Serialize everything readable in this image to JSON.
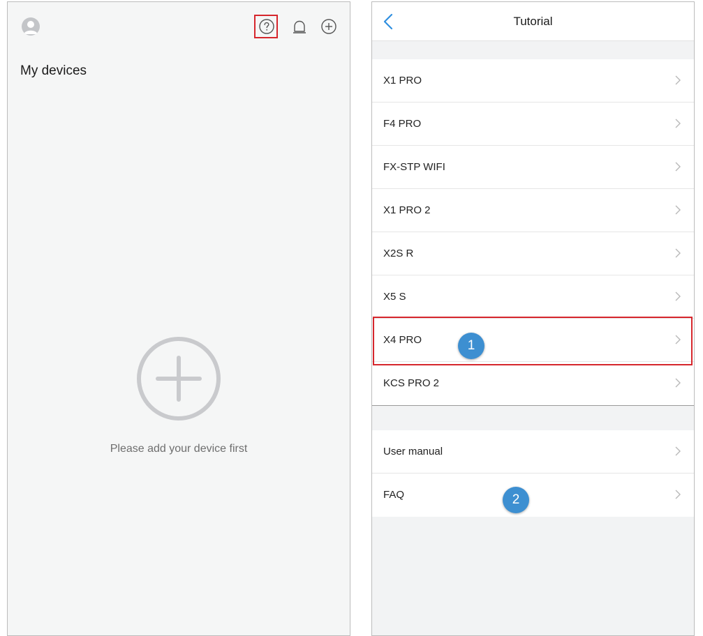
{
  "left_screen": {
    "title": "My devices",
    "empty_message": "Please add your device first",
    "icons": [
      "avatar-icon",
      "help-icon",
      "bell-icon",
      "add-icon"
    ]
  },
  "right_screen": {
    "title": "Tutorial",
    "devices": [
      {
        "label": "X1 PRO"
      },
      {
        "label": "F4 PRO"
      },
      {
        "label": "FX-STP WIFI"
      },
      {
        "label": "X1 PRO 2"
      },
      {
        "label": "X2S R"
      },
      {
        "label": "X5 S"
      },
      {
        "label": "X4 PRO"
      },
      {
        "label": "KCS PRO 2"
      }
    ],
    "help_items": [
      {
        "label": "User manual"
      },
      {
        "label": "FAQ"
      }
    ]
  },
  "annotations": {
    "step_1": "1",
    "step_2": "2"
  },
  "colors": {
    "accent": "#3d8fd1",
    "highlight": "#d6262c",
    "back_arrow": "#2f8fe0"
  }
}
